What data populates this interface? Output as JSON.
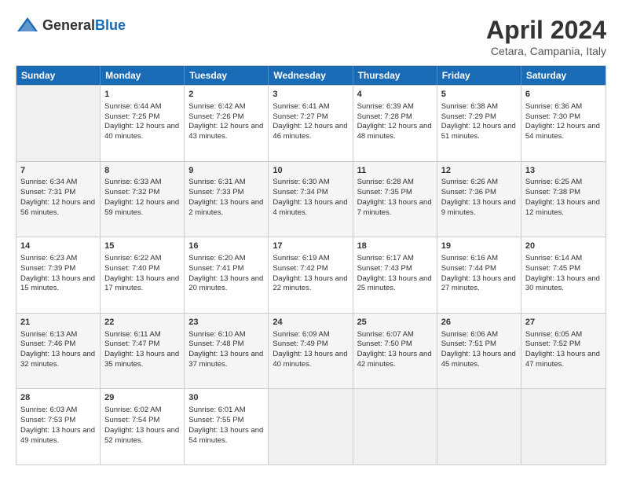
{
  "header": {
    "logo": {
      "general": "General",
      "blue": "Blue"
    },
    "title": "April 2024",
    "subtitle": "Cetara, Campania, Italy"
  },
  "days": [
    "Sunday",
    "Monday",
    "Tuesday",
    "Wednesday",
    "Thursday",
    "Friday",
    "Saturday"
  ],
  "rows": [
    [
      {
        "day": "",
        "empty": true
      },
      {
        "day": "1",
        "sunrise": "Sunrise: 6:44 AM",
        "sunset": "Sunset: 7:25 PM",
        "daylight": "Daylight: 12 hours and 40 minutes."
      },
      {
        "day": "2",
        "sunrise": "Sunrise: 6:42 AM",
        "sunset": "Sunset: 7:26 PM",
        "daylight": "Daylight: 12 hours and 43 minutes."
      },
      {
        "day": "3",
        "sunrise": "Sunrise: 6:41 AM",
        "sunset": "Sunset: 7:27 PM",
        "daylight": "Daylight: 12 hours and 46 minutes."
      },
      {
        "day": "4",
        "sunrise": "Sunrise: 6:39 AM",
        "sunset": "Sunset: 7:28 PM",
        "daylight": "Daylight: 12 hours and 48 minutes."
      },
      {
        "day": "5",
        "sunrise": "Sunrise: 6:38 AM",
        "sunset": "Sunset: 7:29 PM",
        "daylight": "Daylight: 12 hours and 51 minutes."
      },
      {
        "day": "6",
        "sunrise": "Sunrise: 6:36 AM",
        "sunset": "Sunset: 7:30 PM",
        "daylight": "Daylight: 12 hours and 54 minutes."
      }
    ],
    [
      {
        "day": "7",
        "sunrise": "Sunrise: 6:34 AM",
        "sunset": "Sunset: 7:31 PM",
        "daylight": "Daylight: 12 hours and 56 minutes."
      },
      {
        "day": "8",
        "sunrise": "Sunrise: 6:33 AM",
        "sunset": "Sunset: 7:32 PM",
        "daylight": "Daylight: 12 hours and 59 minutes."
      },
      {
        "day": "9",
        "sunrise": "Sunrise: 6:31 AM",
        "sunset": "Sunset: 7:33 PM",
        "daylight": "Daylight: 13 hours and 2 minutes."
      },
      {
        "day": "10",
        "sunrise": "Sunrise: 6:30 AM",
        "sunset": "Sunset: 7:34 PM",
        "daylight": "Daylight: 13 hours and 4 minutes."
      },
      {
        "day": "11",
        "sunrise": "Sunrise: 6:28 AM",
        "sunset": "Sunset: 7:35 PM",
        "daylight": "Daylight: 13 hours and 7 minutes."
      },
      {
        "day": "12",
        "sunrise": "Sunrise: 6:26 AM",
        "sunset": "Sunset: 7:36 PM",
        "daylight": "Daylight: 13 hours and 9 minutes."
      },
      {
        "day": "13",
        "sunrise": "Sunrise: 6:25 AM",
        "sunset": "Sunset: 7:38 PM",
        "daylight": "Daylight: 13 hours and 12 minutes."
      }
    ],
    [
      {
        "day": "14",
        "sunrise": "Sunrise: 6:23 AM",
        "sunset": "Sunset: 7:39 PM",
        "daylight": "Daylight: 13 hours and 15 minutes."
      },
      {
        "day": "15",
        "sunrise": "Sunrise: 6:22 AM",
        "sunset": "Sunset: 7:40 PM",
        "daylight": "Daylight: 13 hours and 17 minutes."
      },
      {
        "day": "16",
        "sunrise": "Sunrise: 6:20 AM",
        "sunset": "Sunset: 7:41 PM",
        "daylight": "Daylight: 13 hours and 20 minutes."
      },
      {
        "day": "17",
        "sunrise": "Sunrise: 6:19 AM",
        "sunset": "Sunset: 7:42 PM",
        "daylight": "Daylight: 13 hours and 22 minutes."
      },
      {
        "day": "18",
        "sunrise": "Sunrise: 6:17 AM",
        "sunset": "Sunset: 7:43 PM",
        "daylight": "Daylight: 13 hours and 25 minutes."
      },
      {
        "day": "19",
        "sunrise": "Sunrise: 6:16 AM",
        "sunset": "Sunset: 7:44 PM",
        "daylight": "Daylight: 13 hours and 27 minutes."
      },
      {
        "day": "20",
        "sunrise": "Sunrise: 6:14 AM",
        "sunset": "Sunset: 7:45 PM",
        "daylight": "Daylight: 13 hours and 30 minutes."
      }
    ],
    [
      {
        "day": "21",
        "sunrise": "Sunrise: 6:13 AM",
        "sunset": "Sunset: 7:46 PM",
        "daylight": "Daylight: 13 hours and 32 minutes."
      },
      {
        "day": "22",
        "sunrise": "Sunrise: 6:11 AM",
        "sunset": "Sunset: 7:47 PM",
        "daylight": "Daylight: 13 hours and 35 minutes."
      },
      {
        "day": "23",
        "sunrise": "Sunrise: 6:10 AM",
        "sunset": "Sunset: 7:48 PM",
        "daylight": "Daylight: 13 hours and 37 minutes."
      },
      {
        "day": "24",
        "sunrise": "Sunrise: 6:09 AM",
        "sunset": "Sunset: 7:49 PM",
        "daylight": "Daylight: 13 hours and 40 minutes."
      },
      {
        "day": "25",
        "sunrise": "Sunrise: 6:07 AM",
        "sunset": "Sunset: 7:50 PM",
        "daylight": "Daylight: 13 hours and 42 minutes."
      },
      {
        "day": "26",
        "sunrise": "Sunrise: 6:06 AM",
        "sunset": "Sunset: 7:51 PM",
        "daylight": "Daylight: 13 hours and 45 minutes."
      },
      {
        "day": "27",
        "sunrise": "Sunrise: 6:05 AM",
        "sunset": "Sunset: 7:52 PM",
        "daylight": "Daylight: 13 hours and 47 minutes."
      }
    ],
    [
      {
        "day": "28",
        "sunrise": "Sunrise: 6:03 AM",
        "sunset": "Sunset: 7:53 PM",
        "daylight": "Daylight: 13 hours and 49 minutes."
      },
      {
        "day": "29",
        "sunrise": "Sunrise: 6:02 AM",
        "sunset": "Sunset: 7:54 PM",
        "daylight": "Daylight: 13 hours and 52 minutes."
      },
      {
        "day": "30",
        "sunrise": "Sunrise: 6:01 AM",
        "sunset": "Sunset: 7:55 PM",
        "daylight": "Daylight: 13 hours and 54 minutes."
      },
      {
        "day": "",
        "empty": true
      },
      {
        "day": "",
        "empty": true
      },
      {
        "day": "",
        "empty": true
      },
      {
        "day": "",
        "empty": true
      }
    ]
  ]
}
